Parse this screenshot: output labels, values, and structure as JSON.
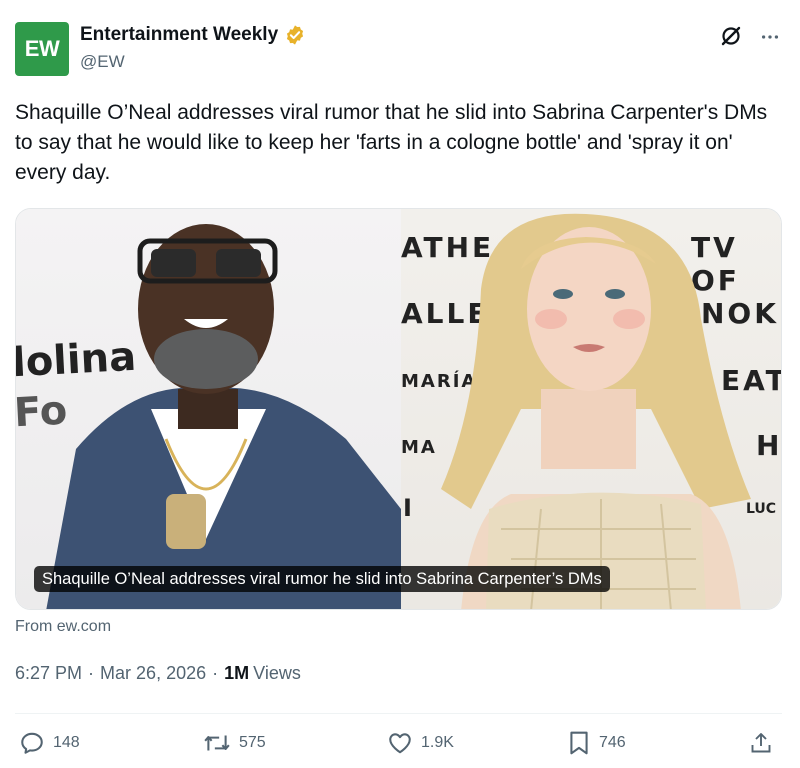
{
  "account": {
    "logo_text": "EW",
    "name": "Entertainment Weekly",
    "handle": "@EW"
  },
  "tweet": {
    "text": "Shaquille O’Neal addresses viral rumor that he slid into Sabrina Carpenter's DMs to say that he would like to keep her 'farts in a cologne bottle' and 'spray it on' every day."
  },
  "media": {
    "caption": "Shaquille O’Neal addresses viral rumor he slid into Sabrina Carpenter’s DMs",
    "left_backdrop": [
      "lolina",
      "Fo"
    ],
    "right_backdrop": [
      "ATHE",
      "TV OF",
      "ALLE",
      "NOKI",
      "MARÍA",
      "EAT",
      "MA",
      "H",
      "I",
      "LUC"
    ]
  },
  "source": "From ew.com",
  "meta": {
    "time": "6:27 PM",
    "date": "Mar 26, 2026",
    "views_count": "1M",
    "views_label": "Views"
  },
  "actions": {
    "replies": "148",
    "reposts": "575",
    "likes": "1.9K",
    "bookmarks": "746"
  },
  "icons": [
    "verified-badge-icon",
    "grok-icon",
    "more-icon",
    "reply-icon",
    "repost-icon",
    "like-icon",
    "bookmark-icon",
    "share-icon"
  ],
  "colors": {
    "logo_bg": "#2f9a4a",
    "verified": "#e8b22a",
    "secondary_text": "#536471",
    "primary_text": "#0f1419"
  }
}
